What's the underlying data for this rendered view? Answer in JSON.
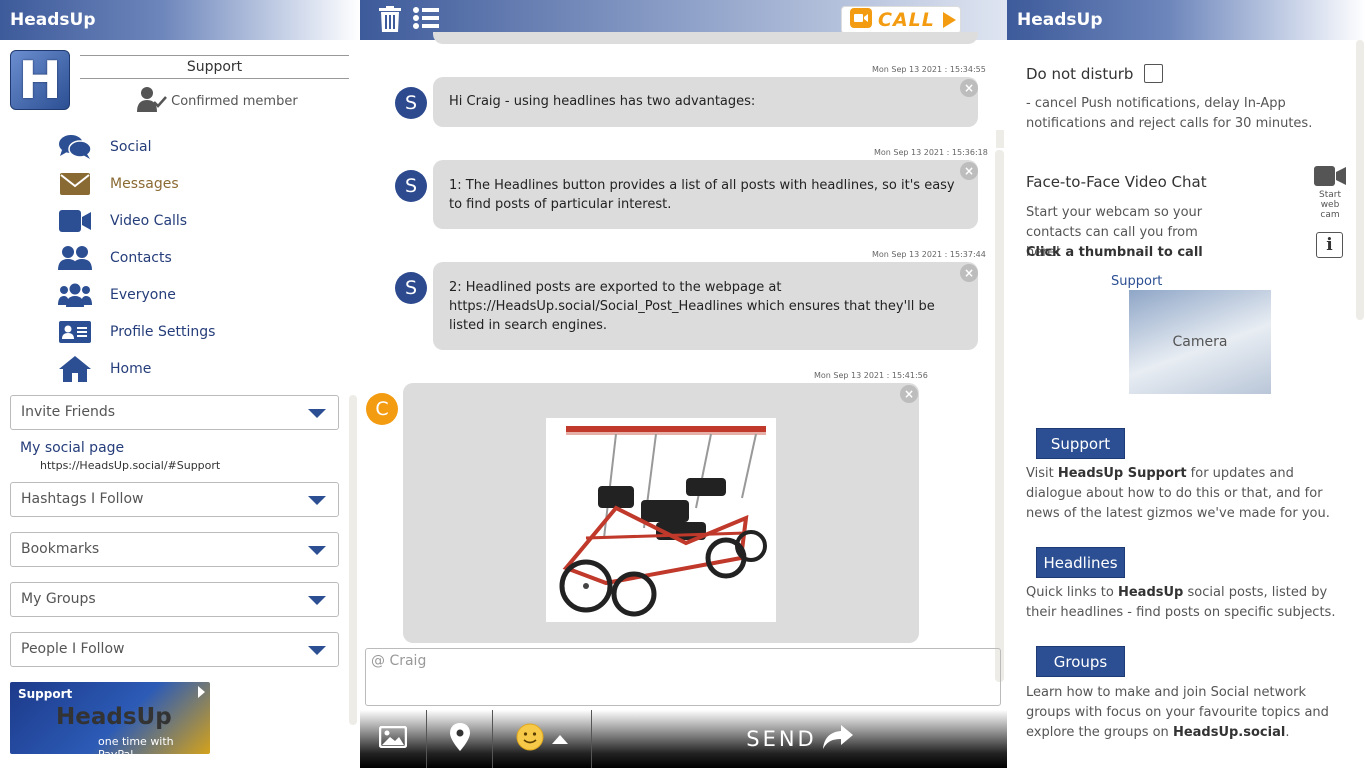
{
  "left": {
    "brand": "HeadsUp",
    "profile_name": "Support",
    "member_status": "Confirmed member",
    "nav": [
      {
        "label": "Social",
        "icon": "chat-bubbles-icon"
      },
      {
        "label": "Messages",
        "icon": "envelope-icon"
      },
      {
        "label": "Video Calls",
        "icon": "video-camera-icon"
      },
      {
        "label": "Contacts",
        "icon": "contacts-icon"
      },
      {
        "label": "Everyone",
        "icon": "everyone-icon"
      },
      {
        "label": "Profile Settings",
        "icon": "id-card-icon"
      },
      {
        "label": "Home",
        "icon": "home-icon"
      }
    ],
    "invite_friends": "Invite Friends",
    "social_page_label": "My social page",
    "social_page_url": "https://HeadsUp.social/#Support",
    "hashtags": "Hashtags I Follow",
    "bookmarks": "Bookmarks",
    "groups": "My Groups",
    "people": "People I Follow",
    "paypal": {
      "top": "Support",
      "brand": "HeadsUp",
      "bottom": "one time with PayPal"
    }
  },
  "mid": {
    "call_label": "CALL",
    "messages": [
      {
        "avatar": "S",
        "timestamp": "Mon Sep 13 2021 : 15:34:55",
        "text": "Hi Craig - using headlines has two advantages:"
      },
      {
        "avatar": "S",
        "timestamp": "Mon Sep 13 2021 : 15:36:18",
        "text": "1: The Headlines button provides a list of all posts with headlines, so it's easy to find posts of particular interest."
      },
      {
        "avatar": "S",
        "timestamp": "Mon Sep 13 2021 : 15:37:44",
        "text": "2: Headlined posts are exported to the webpage at https://HeadsUp.social/Social_Post_Headlines which ensures that they'll be listed in search engines."
      },
      {
        "avatar": "C",
        "timestamp": "Mon Sep 13 2021 : 15:41:56",
        "image": "red four-wheel surrey bike"
      }
    ],
    "input_placeholder": "@ Craig",
    "send_label": "SEND"
  },
  "right": {
    "brand": "HeadsUp",
    "dnd_label": "Do not disturb",
    "dnd_desc": "- cancel Push notifications, delay In-App notifications and reject calls for 30 minutes.",
    "video_title": "Face-to-Face Video Chat",
    "webcam_label": "Start web cam",
    "video_desc": "Start your webcam so your contacts can call you from here!",
    "video_click": "Click a thumbnail to call",
    "thumb_name": "Support",
    "camera_label": "Camera",
    "support_btn": "Support",
    "support_desc_pre": "Visit ",
    "support_desc_bold": "HeadsUp Support",
    "support_desc_post": " for updates and dialogue about how to do this or that, and for news of the latest gizmos we've made for you.",
    "headlines_btn": "Headlines",
    "headlines_desc_pre": "Quick links to ",
    "headlines_desc_bold": "HeadsUp",
    "headlines_desc_post": " social posts, listed by their headlines - find posts on specific subjects.",
    "groups_btn": "Groups",
    "groups_desc_pre": "Learn how to make and join Social network groups with focus on your favourite topics and explore the groups on ",
    "groups_desc_bold": "HeadsUp.social",
    "groups_desc_post": "."
  },
  "colors": {
    "brand_blue": "#2c4f93",
    "accent_orange": "#f39c12",
    "bubble_gray": "#dcdcdc"
  }
}
